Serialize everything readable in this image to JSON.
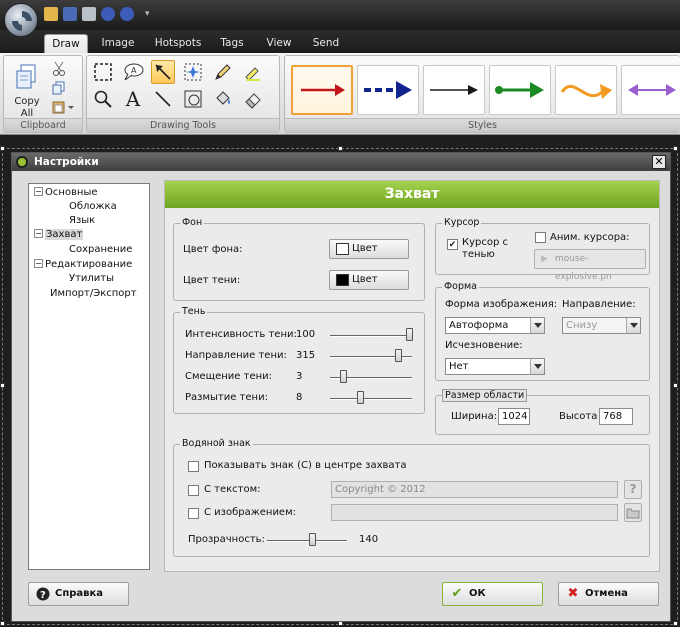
{
  "ribbon": {
    "tabs": [
      {
        "label": "Draw",
        "active": true
      },
      {
        "label": "Image",
        "active": false
      },
      {
        "label": "Hotspots",
        "active": false
      },
      {
        "label": "Tags",
        "active": false
      },
      {
        "label": "View",
        "active": false
      },
      {
        "label": "Send",
        "active": false
      }
    ],
    "copy_all_label": "Copy All",
    "groups": {
      "clipboard": "Clipboard",
      "drawing_tools": "Drawing Tools",
      "styles": "Styles"
    },
    "style_colors": [
      "#c0161c",
      "#12248f",
      "#1a1a1a",
      "#1a8a24",
      "#f29a21",
      "#9a5fd0"
    ]
  },
  "dialog": {
    "title": "Настройки",
    "close": "✕",
    "tree": {
      "basic": "Основные",
      "skin": "Обложка",
      "language": "Язык",
      "capture": "Захват",
      "saving": "Сохранение",
      "editing": "Редактирование",
      "utilities": "Утилиты",
      "import_export": "Импорт/Экспорт"
    },
    "banner": "Захват",
    "background": {
      "legend": "Фон",
      "bg_color_label": "Цвет фона:",
      "shadow_color_label": "Цвет тени:",
      "color_button": "Цвет",
      "bg_color": "#ffffff",
      "shadow_color": "#000000"
    },
    "shadow": {
      "legend": "Тень",
      "intensity_label": "Интенсивность тени:",
      "intensity_value": "100",
      "direction_label": "Направление тени:",
      "direction_value": "315",
      "offset_label": "Смещение тени:",
      "offset_value": "3",
      "blur_label": "Размытие тени:",
      "blur_value": "8"
    },
    "cursor": {
      "legend": "Курсор",
      "cursor_shadow_label": "Курсор с тенью",
      "cursor_shadow_checked": true,
      "animated_label": "Аним. курсора:",
      "animated_checked": false,
      "animated_value": "mouse-explosive.pn"
    },
    "shape": {
      "legend": "Форма",
      "image_shape_label": "Форма изображения:",
      "image_shape_value": "Автоформа",
      "direction_label": "Направление:",
      "direction_value": "Снизу",
      "fade_label": "Исчезновение:",
      "fade_value": "Нет"
    },
    "area": {
      "legend": "Размер области",
      "width_label": "Ширина:",
      "width_value": "1024",
      "height_label": "Высота",
      "height_value": "768"
    },
    "watermark": {
      "legend": "Водяной знак",
      "show_label": "Показывать знак (C) в центре захвата",
      "text_label": "С текстом:",
      "text_value": "Copyright © 2012",
      "image_label": "С изображением:",
      "image_value": "",
      "help": "?",
      "transparency_label": "Прозрачность:",
      "transparency_value": "140"
    },
    "buttons": {
      "help": "Справка",
      "ok": "ОК",
      "cancel": "Отмена"
    }
  }
}
